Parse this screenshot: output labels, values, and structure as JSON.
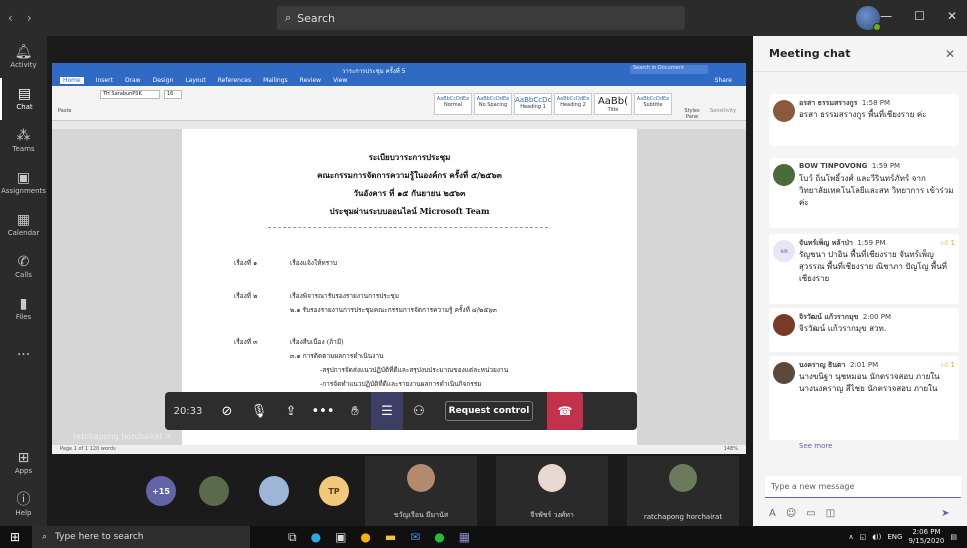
{
  "topbar": {
    "search_label": "Search"
  },
  "rail": {
    "items": [
      {
        "label": "Activity",
        "icon": "bell-icon"
      },
      {
        "label": "Chat",
        "icon": "chat-icon"
      },
      {
        "label": "Teams",
        "icon": "teams-icon"
      },
      {
        "label": "Assignments",
        "icon": "assignments-icon"
      },
      {
        "label": "Calendar",
        "icon": "calendar-icon"
      },
      {
        "label": "Calls",
        "icon": "phone-icon"
      },
      {
        "label": "Files",
        "icon": "file-icon"
      },
      {
        "label": "...",
        "icon": "more-icon"
      }
    ],
    "bottom": [
      {
        "label": "Apps",
        "icon": "apps-icon"
      },
      {
        "label": "Help",
        "icon": "help-icon"
      }
    ]
  },
  "word": {
    "title": "วาระการประชุม ครั้งที่ 5",
    "tabs": [
      "Home",
      "Insert",
      "Draw",
      "Design",
      "Layout",
      "References",
      "Mailings",
      "Review",
      "View"
    ],
    "share_label": "Share",
    "search_placeholder": "Search in Document",
    "font_name": "TH SarabunPSK",
    "font_size": "16",
    "paste_label": "Paste",
    "styles": [
      "Normal",
      "No Spacing",
      "Heading 1",
      "Heading 2",
      "Title",
      "Subtitle"
    ],
    "styles_pane": "Styles Pane",
    "sensitivity": "Sensitivity",
    "status_left": "Page 1 of 1   120 words",
    "status_right": "148%",
    "doc": {
      "title_lines": [
        "ระเบียบวาระการประชุม",
        "คณะกรรมการจัดการความรู้ในองค์กร ครั้งที่ ๕/๒๕๖๓",
        "วันอังคาร ที่ ๑๕ กันยายน ๒๕๖๓",
        "ประชุมผ่านระบบออนไลน์ Microsoft Team"
      ],
      "agenda": [
        {
          "no": "เรื่องที่ ๑",
          "text": "เรื่องแจ้งให้ทราบ"
        },
        {
          "no": "เรื่องที่ ๒",
          "text": "เรื่องพิจารณารับรองรายงานการประชุม"
        },
        {
          "no": "",
          "text": "๒.๑ รับรองรายงานการประชุมคณะกรรมการจัดการความรู้ ครั้งที่ ๔/๒๕๖๓"
        },
        {
          "no": "เรื่องที่ ๓",
          "text": "เรื่องสืบเนื่อง (ถ้ามี)"
        },
        {
          "no": "",
          "text": "๓.๑ การติดตามผลการดำเนินงาน"
        },
        {
          "no": "",
          "text": "-สรุปการจัดส่งแนวปฏิบัติที่ดีและสรุปงบประมาณของแต่ละหน่วยงาน"
        },
        {
          "no": "",
          "text": "-การจัดทำแนวปฏิบัติที่ดีและรายงานผลการดำเนินกิจกรรม"
        }
      ]
    }
  },
  "call": {
    "duration": "20:33",
    "request_control": "Request control",
    "presenter_name": "ratchapong horchairat"
  },
  "gallery": {
    "overflow": "+15",
    "initials": "TP",
    "names": [
      "ขวัญเรือน มีมานัส",
      "จีรพัชร์ วงศ์ทา",
      "ratchapong horchairat"
    ]
  },
  "chat": {
    "title": "Meeting chat",
    "messages": [
      {
        "sender": "อรสา ธรรมสรางกูร",
        "time": "1:58 PM",
        "body": "อรสา ธรรมสรางกูร พื้นที่เชียงราย ค่ะ",
        "likes": ""
      },
      {
        "sender": "BOW TINPOVONG",
        "time": "1:59 PM",
        "body": "โบว์ ถิ่นโพธิ์วงศ์ และวีรินทร์ภัทร์ จาก วิทยาลัยเทคโนโลยีและสห วิทยาการ เข้าร่วมค่ะ",
        "likes": ""
      },
      {
        "sender": "จันทร์เพ็ญ หล้าป่า",
        "time": "1:59 PM",
        "body": "รัญชนา ปาอิน พื้นที่เชียงราย จันทร์เพ็ญ สุวรรณ พื้นที่เชียงราย ณิชาภา ปัญโญ พื้นที่เชียงราย",
        "likes": "1",
        "avatar_initials": "จห"
      },
      {
        "sender": "จิรวัฒน์ แก้วรากมุข",
        "time": "2:00 PM",
        "body": "จิรวัฒน์ แก้วรากมุข สวท.",
        "likes": ""
      },
      {
        "sender": "นงคราญ ธินตา",
        "time": "2:01 PM",
        "body": "นางขนิฐา นุชหมอน นักตรวจสอบ ภายใน นางนงคราญ สีไชย นักตรวจสอบ ภายใน",
        "likes": "1"
      }
    ],
    "see_more": "See more",
    "compose_placeholder": "Type a new message"
  },
  "taskbar": {
    "search_placeholder": "Type here to search",
    "lang": "ENG",
    "time": "2:06 PM",
    "date": "9/15/2020"
  }
}
